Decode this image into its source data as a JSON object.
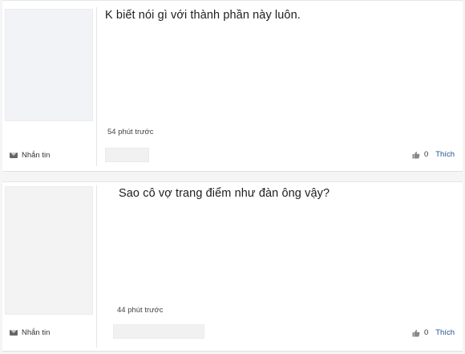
{
  "comments": [
    {
      "text": "K biết nói gì với thành phần này luôn.",
      "time": "54 phút trước",
      "message_label": "Nhắn tin",
      "like_count": "0",
      "like_label": "Thích"
    },
    {
      "text": "Sao cô vợ trang điểm như đàn ông vậy?",
      "time": "44 phút trước",
      "message_label": "Nhắn tin",
      "like_count": "0",
      "like_label": "Thích"
    }
  ],
  "colors": {
    "like_link": "#1f4e8c",
    "background": "#f5f5f5"
  },
  "icons": {
    "message": "mail-icon",
    "like": "thumbs-up-icon"
  }
}
